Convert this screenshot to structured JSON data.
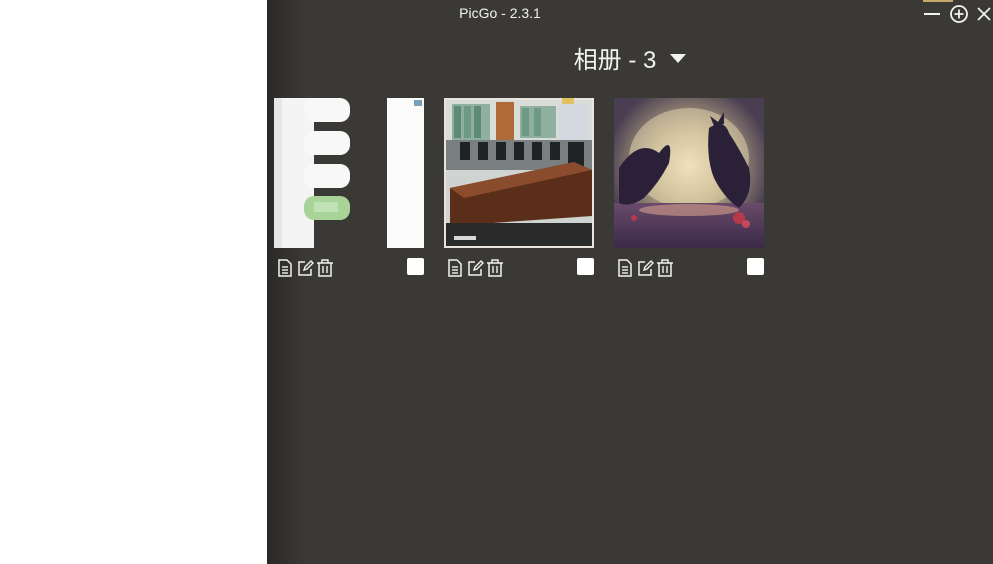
{
  "window": {
    "title": "PicGo - 2.3.1",
    "controls": [
      "minimize-icon",
      "maximize-icon",
      "close-icon"
    ]
  },
  "gallery": {
    "album_title": "相册 - 3",
    "dropdown_icon": "caret-down-icon",
    "images": [
      {
        "description_icon": "file-text-icon",
        "edit_icon": "edit-icon",
        "delete_icon": "trash-icon",
        "selected": false,
        "thumbnail": "ui-screenshot-thumbnail"
      },
      {
        "description_icon": "file-text-icon",
        "edit_icon": "edit-icon",
        "delete_icon": "trash-icon",
        "selected": false,
        "thumbnail": "meeting-room-photo"
      },
      {
        "description_icon": "file-text-icon",
        "edit_icon": "edit-icon",
        "delete_icon": "trash-icon",
        "selected": false,
        "thumbnail": "fantasy-dragons-moon-art"
      }
    ]
  },
  "colors": {
    "window_bg": "#3b3935",
    "text": "#f2f2f2",
    "accent": "#c8a96a"
  }
}
